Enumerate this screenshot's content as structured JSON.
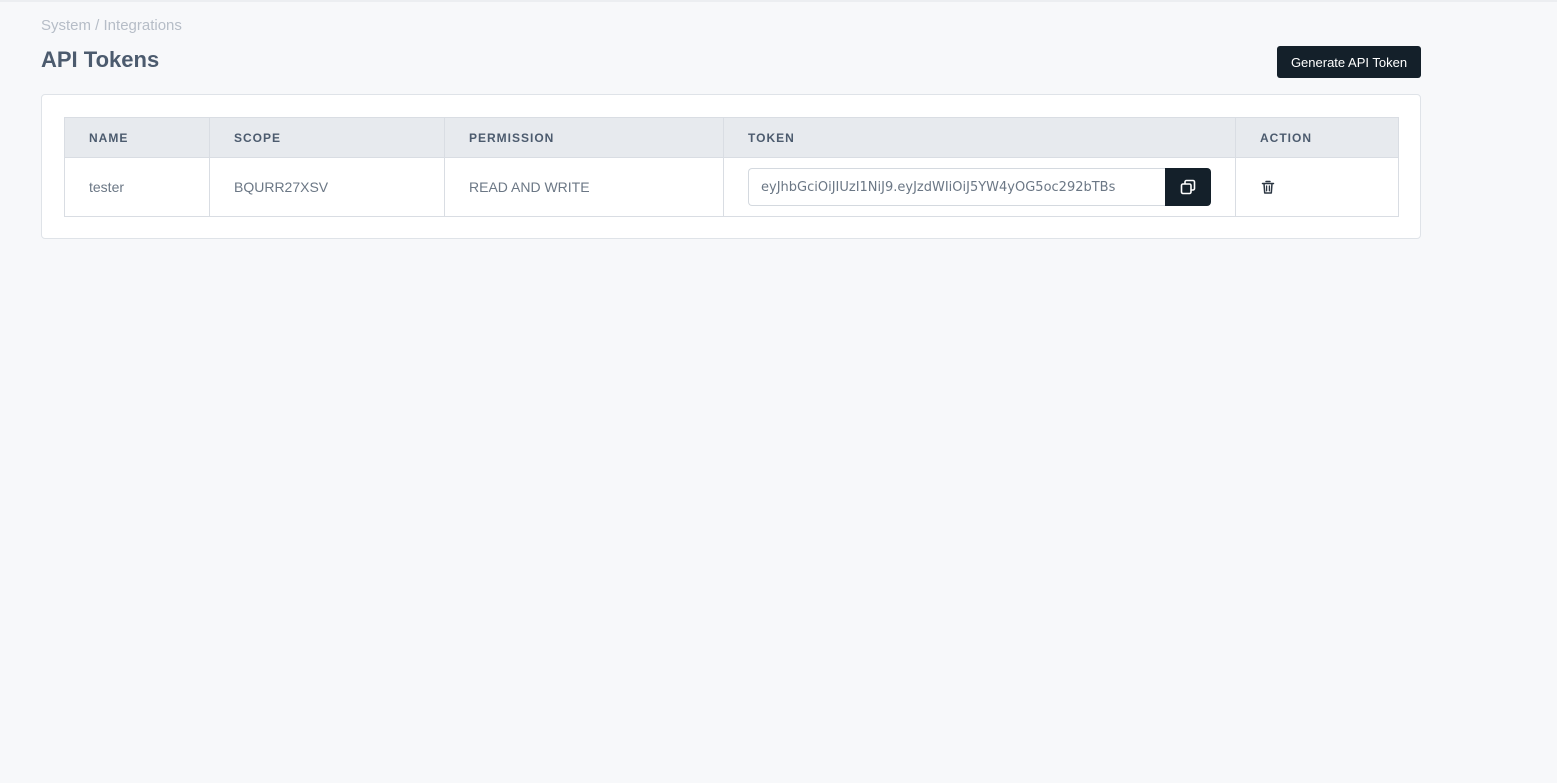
{
  "breadcrumb": "System / Integrations",
  "page_title": "API Tokens",
  "generate_button_label": "Generate API Token",
  "table": {
    "columns": [
      "NAME",
      "SCOPE",
      "PERMISSION",
      "TOKEN",
      "ACTION"
    ],
    "rows": [
      {
        "name": "tester",
        "scope": "BQURR27XSV",
        "permission": "READ AND WRITE",
        "token": "eyJhbGciOiJIUzI1NiJ9.eyJzdWIiOiJ5YW4yOG5oc292bTBs",
        "copy_icon": "copy-icon",
        "delete_icon": "trash-icon"
      }
    ]
  },
  "colors": {
    "primary_dark": "#14202a",
    "background": "#f7f8fa",
    "header_bg": "#e7eaee"
  }
}
